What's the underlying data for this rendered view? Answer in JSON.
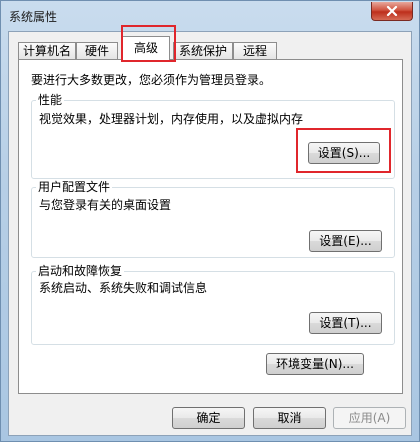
{
  "window": {
    "title": "系统属性"
  },
  "tabs": [
    {
      "label": "计算机名"
    },
    {
      "label": "硬件"
    },
    {
      "label": "高级"
    },
    {
      "label": "系统保护"
    },
    {
      "label": "远程"
    }
  ],
  "notice": "要进行大多数更改，您必须作为管理员登录。",
  "performance": {
    "title": "性能",
    "description": "视觉效果，处理器计划，内存使用，以及虚拟内存",
    "button": "设置(S)..."
  },
  "user_profiles": {
    "title": "用户配置文件",
    "description": "与您登录有关的桌面设置",
    "button": "设置(E)..."
  },
  "startup_recovery": {
    "title": "启动和故障恢复",
    "description": "系统启动、系统失败和调试信息",
    "button": "设置(T)..."
  },
  "env_button": "环境变量(N)...",
  "footer": {
    "ok": "确定",
    "cancel": "取消",
    "apply": "应用(A)"
  },
  "colors": {
    "highlight": "#e0262c",
    "close_button": "#c9412c"
  },
  "icons": {
    "close": "close-icon"
  }
}
